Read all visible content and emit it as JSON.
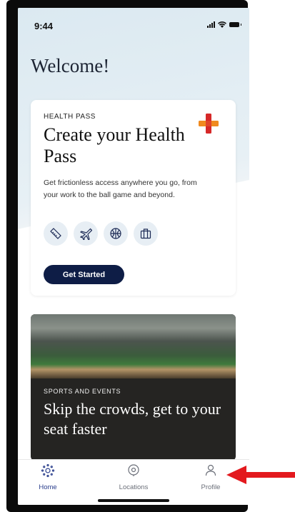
{
  "status_bar": {
    "time": "9:44"
  },
  "greeting": "Welcome!",
  "health_card": {
    "kicker": "HEALTH PASS",
    "title": "Create your Health Pass",
    "description": "Get frictionless access anywhere you go, from your work to the ball game and beyond.",
    "icons": [
      "ticket-icon",
      "airplane-icon",
      "basketball-icon",
      "briefcase-icon"
    ],
    "button_label": "Get Started",
    "accent_colors": {
      "plus_red": "#d62828",
      "plus_orange": "#f08a1f",
      "button": "#0e1d46"
    }
  },
  "sports_card": {
    "kicker": "SPORTS AND EVENTS",
    "title": "Skip the crowds, get to your seat faster"
  },
  "tab_bar": {
    "tabs": [
      {
        "label": "Home",
        "icon": "home-icon",
        "active": true
      },
      {
        "label": "Locations",
        "icon": "location-pin-icon",
        "active": false
      },
      {
        "label": "Profile",
        "icon": "profile-icon",
        "active": false
      }
    ],
    "active_color": "#2a3e8c"
  },
  "annotation": {
    "color": "#e3191e"
  }
}
